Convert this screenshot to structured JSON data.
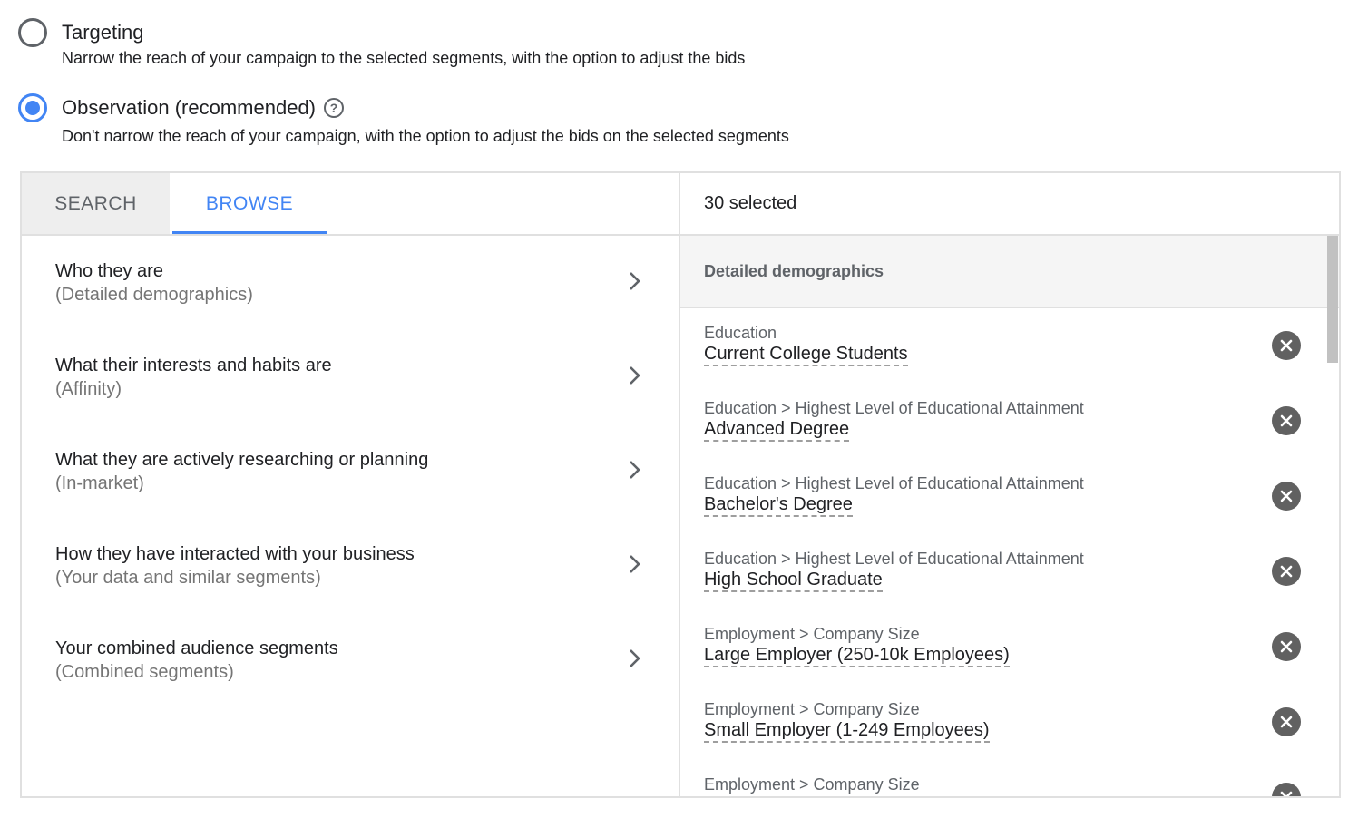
{
  "bid_options": [
    {
      "title": "Targeting",
      "description": "Narrow the reach of your campaign to the selected segments, with the option to adjust the bids",
      "checked": false
    },
    {
      "title": "Observation (recommended)",
      "description": "Don't narrow the reach of your campaign, with the option to adjust the bids on the selected segments",
      "checked": true,
      "help_icon": "?"
    }
  ],
  "tabs": {
    "search_label": "SEARCH",
    "browse_label": "BROWSE",
    "active": "BROWSE"
  },
  "browse_items": [
    {
      "title": "Who they are",
      "subtitle": "(Detailed demographics)"
    },
    {
      "title": "What their interests and habits are",
      "subtitle": "(Affinity)"
    },
    {
      "title": "What they are actively researching or planning",
      "subtitle": "(In-market)"
    },
    {
      "title": "How they have interacted with your business",
      "subtitle": "(Your data and similar segments)"
    },
    {
      "title": "Your combined audience segments",
      "subtitle": "(Combined segments)"
    }
  ],
  "selected": {
    "count_label": "30 selected",
    "group_label": "Detailed demographics",
    "items": [
      {
        "category": "Education",
        "value": "Current College Students"
      },
      {
        "category": "Education > Highest Level of Educational Attainment",
        "value": "Advanced Degree"
      },
      {
        "category": "Education > Highest Level of Educational Attainment",
        "value": "Bachelor's Degree"
      },
      {
        "category": "Education > Highest Level of Educational Attainment",
        "value": "High School Graduate"
      },
      {
        "category": "Employment > Company Size",
        "value": "Large Employer (250-10k Employees)"
      },
      {
        "category": "Employment > Company Size",
        "value": "Small Employer (1-249 Employees)"
      },
      {
        "category": "Employment > Company Size",
        "value": ""
      }
    ]
  },
  "colors": {
    "accent": "#4285f4",
    "text_primary": "#202124",
    "text_secondary": "#757575",
    "remove_icon_bg": "#616161"
  }
}
